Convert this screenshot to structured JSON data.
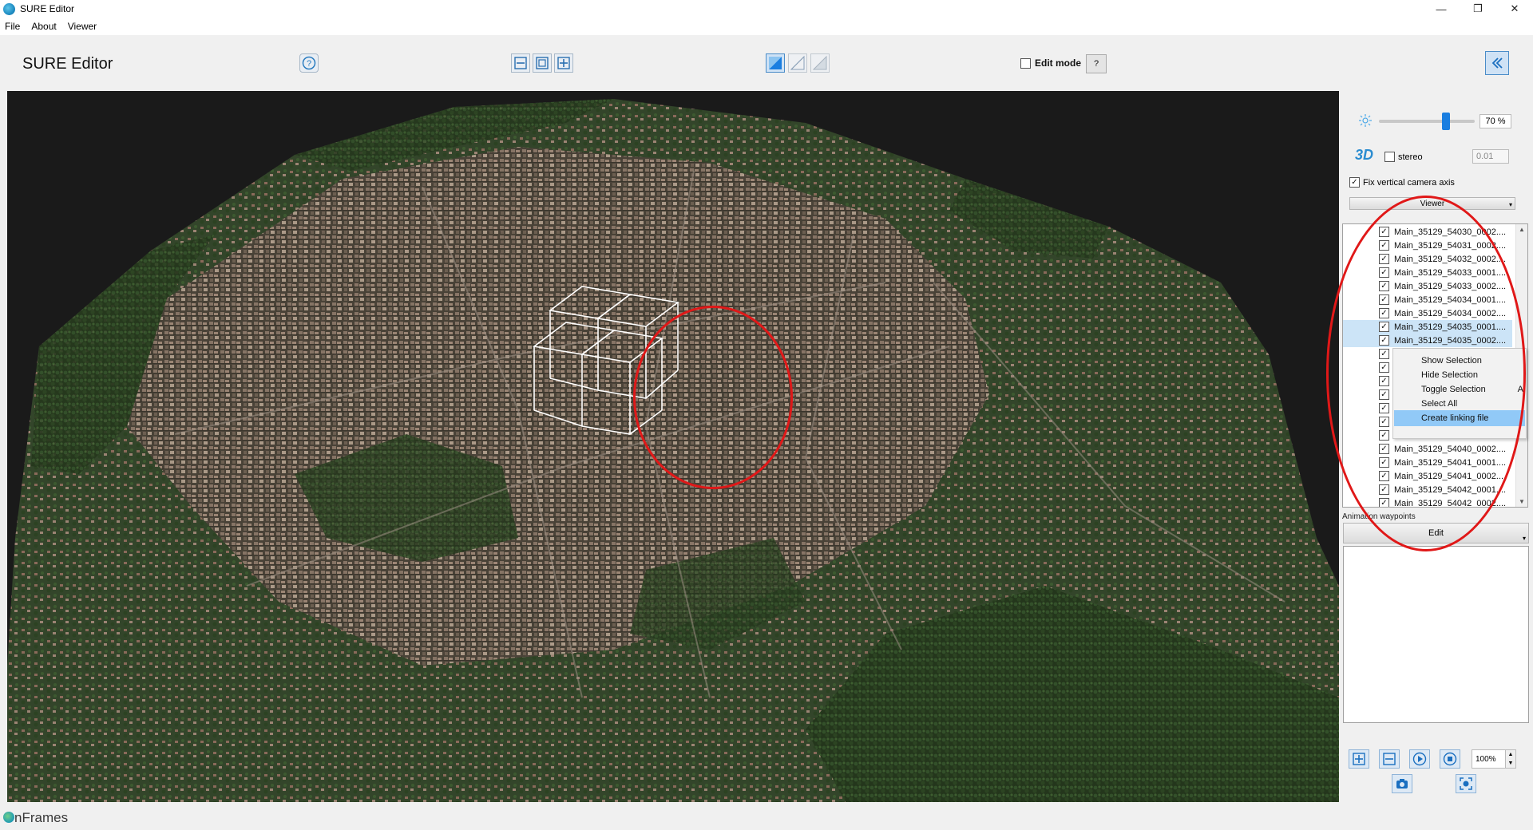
{
  "window": {
    "title": "SURE Editor",
    "controls": [
      "—",
      "❐",
      "✕"
    ]
  },
  "menu": [
    "File",
    "About",
    "Viewer"
  ],
  "toolbar": {
    "app_name": "SURE Editor",
    "edit_mode_label": "Edit mode",
    "edit_mode_checked": false,
    "help_button_label": "?"
  },
  "panel": {
    "brightness_value": "70 %",
    "brightness_fraction": 0.7,
    "label_3d": "3D",
    "stereo_label": "stereo",
    "stereo_checked": false,
    "stereo_value": "0.01",
    "fix_camera_label": "Fix vertical camera axis",
    "fix_camera_checked": true,
    "viewer_dropdown": "Viewer",
    "files": [
      {
        "name": "Main_35129_54030_0002....",
        "checked": true,
        "selected": false
      },
      {
        "name": "Main_35129_54031_0002....",
        "checked": true,
        "selected": false
      },
      {
        "name": "Main_35129_54032_0002....",
        "checked": true,
        "selected": false
      },
      {
        "name": "Main_35129_54033_0001....",
        "checked": true,
        "selected": false
      },
      {
        "name": "Main_35129_54033_0002....",
        "checked": true,
        "selected": false
      },
      {
        "name": "Main_35129_54034_0001....",
        "checked": true,
        "selected": false
      },
      {
        "name": "Main_35129_54034_0002....",
        "checked": true,
        "selected": false
      },
      {
        "name": "Main_35129_54035_0001....",
        "checked": true,
        "selected": true
      },
      {
        "name": "Main_35129_54035_0002....",
        "checked": true,
        "selected": true
      },
      {
        "name": "",
        "checked": true,
        "selected": false
      },
      {
        "name": "",
        "checked": true,
        "selected": false
      },
      {
        "name": "",
        "checked": true,
        "selected": false
      },
      {
        "name": "",
        "checked": true,
        "selected": false
      },
      {
        "name": "",
        "checked": true,
        "selected": false
      },
      {
        "name": "",
        "checked": true,
        "selected": false
      },
      {
        "name": "",
        "checked": true,
        "selected": false
      },
      {
        "name": "Main_35129_54040_0002....",
        "checked": true,
        "selected": false
      },
      {
        "name": "Main_35129_54041_0001....",
        "checked": true,
        "selected": false
      },
      {
        "name": "Main_35129_54041_0002....",
        "checked": true,
        "selected": false
      },
      {
        "name": "Main_35129_54042_0001....",
        "checked": true,
        "selected": false
      },
      {
        "name": "Main_35129_54042_0002....",
        "checked": true,
        "selected": false
      }
    ],
    "context_menu": [
      {
        "label": "Show Selection",
        "shortcut": "",
        "highlighted": false
      },
      {
        "label": "Hide Selection",
        "shortcut": "",
        "highlighted": false
      },
      {
        "label": "Toggle Selection",
        "shortcut": "A",
        "highlighted": false
      },
      {
        "label": "Select All",
        "shortcut": "",
        "highlighted": false
      },
      {
        "label": "Create linking file",
        "shortcut": "",
        "highlighted": true
      }
    ],
    "animation_label": "Animation waypoints",
    "edit_dropdown": "Edit",
    "zoom_value": "100%"
  },
  "status": {
    "logo_text": "nFrames"
  },
  "colors": {
    "accent": "#1a7ee0",
    "annotation": "#e01818",
    "selection": "#cce4f7",
    "menu_highlight": "#91c9f7"
  }
}
